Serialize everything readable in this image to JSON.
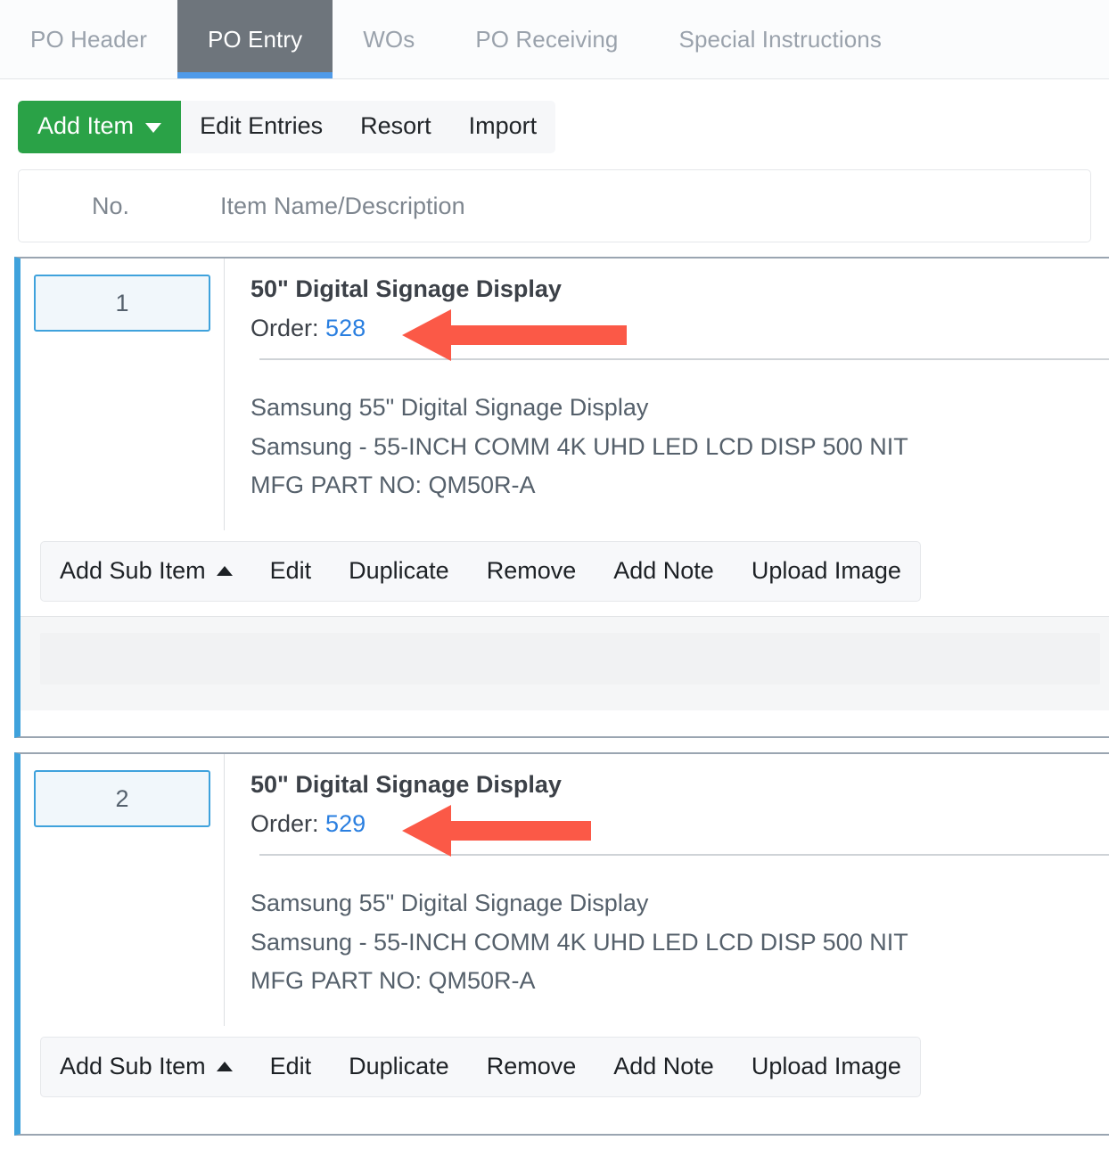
{
  "tabs": [
    {
      "label": "PO Header",
      "active": false
    },
    {
      "label": "PO Entry",
      "active": true
    },
    {
      "label": "WOs",
      "active": false
    },
    {
      "label": "PO Receiving",
      "active": false
    },
    {
      "label": "Special Instructions",
      "active": false
    }
  ],
  "toolbar": {
    "add_item_label": "Add Item",
    "edit_entries_label": "Edit Entries",
    "resort_label": "Resort",
    "import_label": "Import"
  },
  "table": {
    "columns": {
      "no": "No.",
      "description": "Item Name/Description"
    }
  },
  "items": [
    {
      "no": "1",
      "title": "50\" Digital Signage Display",
      "order_label": "Order:",
      "order_value": "528",
      "description_lines": [
        "Samsung 55\" Digital Signage Display",
        "Samsung - 55-INCH COMM 4K UHD LED LCD DISP 500 NIT",
        "MFG PART NO: QM50R-A"
      ],
      "actions": {
        "add_sub_item": "Add Sub Item",
        "edit": "Edit",
        "duplicate": "Duplicate",
        "remove": "Remove",
        "add_note": "Add Note",
        "upload_image": "Upload Image"
      }
    },
    {
      "no": "2",
      "title": "50\" Digital Signage Display",
      "order_label": "Order:",
      "order_value": "529",
      "description_lines": [
        "Samsung 55\" Digital Signage Display",
        "Samsung - 55-INCH COMM 4K UHD LED LCD DISP 500 NIT",
        "MFG PART NO: QM50R-A"
      ],
      "actions": {
        "add_sub_item": "Add Sub Item",
        "edit": "Edit",
        "duplicate": "Duplicate",
        "remove": "Remove",
        "add_note": "Add Note",
        "upload_image": "Upload Image"
      }
    }
  ],
  "annotations": [
    {
      "type": "arrow-left",
      "target": "order-link-528"
    },
    {
      "type": "arrow-left",
      "target": "order-link-529"
    }
  ],
  "colors": {
    "accent_blue": "#3fa2dc",
    "tab_active_bg": "#6e757c",
    "tab_active_underline": "#4f9ae8",
    "primary_green": "#2aa247",
    "link_blue": "#2a7fe0",
    "annotation_red": "#fb5947"
  }
}
